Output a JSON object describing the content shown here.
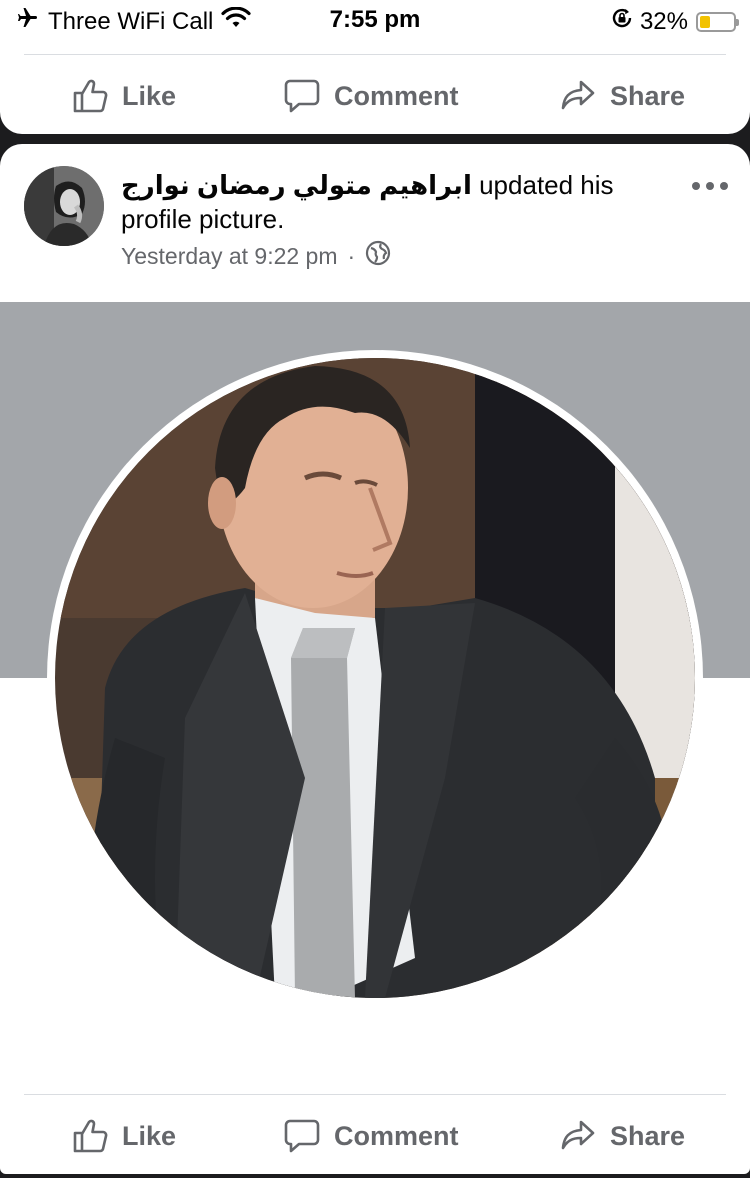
{
  "status_bar": {
    "carrier": "Three WiFi Call",
    "time": "7:55 pm",
    "battery_percent": "32%",
    "battery_level": 0.32,
    "icons": [
      "airplane-icon",
      "wifi-icon",
      "rotation-lock-icon",
      "battery-icon"
    ]
  },
  "previous_post": {
    "actions": {
      "like": "Like",
      "comment": "Comment",
      "share": "Share"
    }
  },
  "post": {
    "author": "ابراهيم متولي رمضان نوارج",
    "action_text": " updated his profile picture.",
    "timestamp": "Yesterday at 9:22 pm",
    "separator": "·",
    "privacy_icon": "globe-icon",
    "more_icon": "more-icon",
    "actions": {
      "like": "Like",
      "comment": "Comment",
      "share": "Share"
    }
  },
  "colors": {
    "secondary_text": "#65676b",
    "cover_bg": "#a3a6aa",
    "battery_fill": "#f2c200"
  }
}
